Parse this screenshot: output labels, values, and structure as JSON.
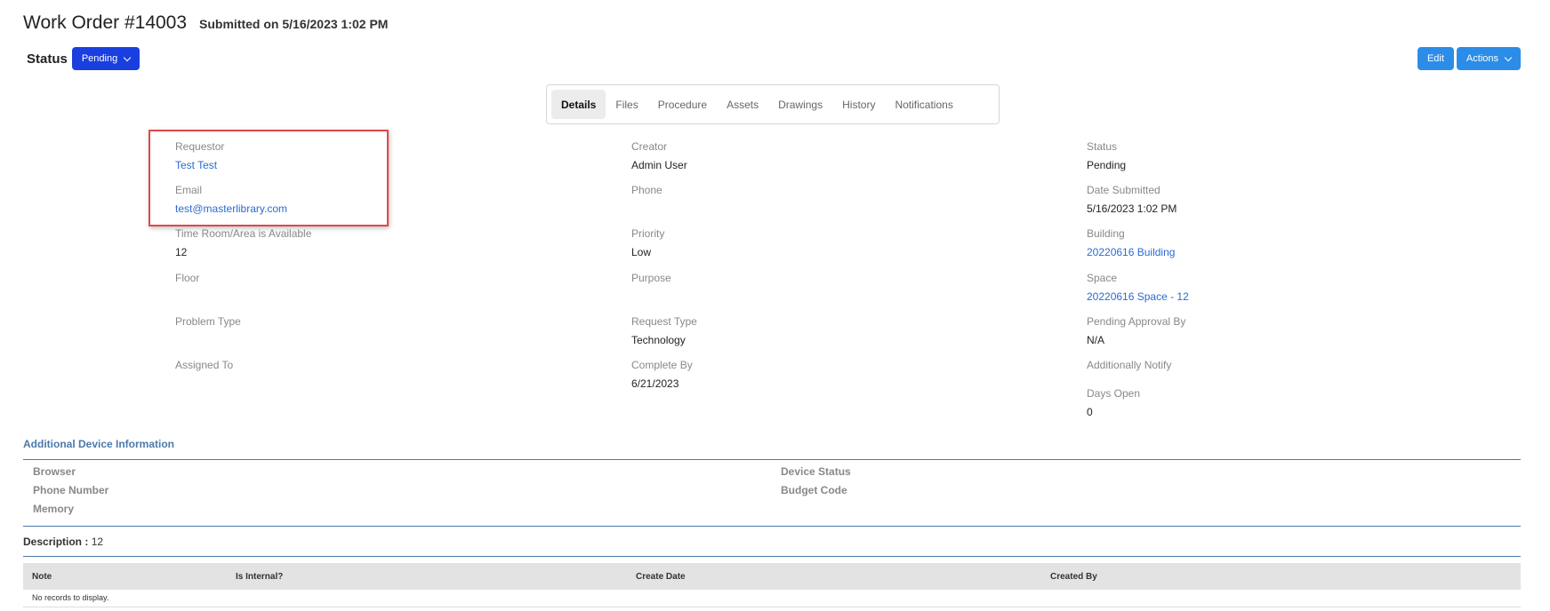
{
  "header": {
    "title": "Work Order #14003",
    "subtitle": "Submitted on 5/16/2023 1:02 PM",
    "status_label": "Status",
    "status_value": "Pending",
    "edit_label": "Edit",
    "actions_label": "Actions"
  },
  "tabs": [
    "Details",
    "Files",
    "Procedure",
    "Assets",
    "Drawings",
    "History",
    "Notifications"
  ],
  "active_tab": "Details",
  "details": {
    "col1": [
      {
        "label": "Requestor",
        "value": "Test Test"
      },
      {
        "label": "Email",
        "value": "test@masterlibrary.com"
      },
      {
        "label": "Time Room/Area is Available",
        "value": "12"
      },
      {
        "label": "Floor",
        "value": ""
      },
      {
        "label": "Problem Type",
        "value": ""
      },
      {
        "label": "Assigned To",
        "value": ""
      }
    ],
    "col2": [
      {
        "label": "Creator",
        "value": "Admin User"
      },
      {
        "label": "Phone",
        "value": ""
      },
      {
        "label": "Priority",
        "value": "Low"
      },
      {
        "label": "Purpose",
        "value": ""
      },
      {
        "label": "Request Type",
        "value": "Technology"
      },
      {
        "label": "Complete By",
        "value": "6/21/2023"
      }
    ],
    "col3": [
      {
        "label": "Status",
        "value": "Pending"
      },
      {
        "label": "Date Submitted",
        "value": "5/16/2023 1:02 PM"
      },
      {
        "label": "Building",
        "value": "20220616 Building"
      },
      {
        "label": "Space",
        "value": "20220616 Space - 12"
      },
      {
        "label": "Pending Approval By",
        "value": "N/A"
      },
      {
        "label": "Additionally Notify",
        "value": ""
      },
      {
        "label": "Days Open",
        "value": "0"
      }
    ]
  },
  "device_info": {
    "title": "Additional Device Information",
    "left": [
      "Browser",
      "Phone Number",
      "Memory"
    ],
    "right": [
      "Device Status",
      "Budget Code"
    ]
  },
  "description": {
    "label": "Description :",
    "value": "12"
  },
  "notes_grid": {
    "columns": [
      "Note",
      "Is Internal?",
      "Create Date",
      "Created By"
    ],
    "empty_text": "No records to display."
  },
  "colors": {
    "status_button": "#1a3fe0",
    "action_button": "#2b8de8",
    "link": "#2a6bd4",
    "section_accent": "#4b7aab",
    "highlight_box": "#e04848"
  }
}
